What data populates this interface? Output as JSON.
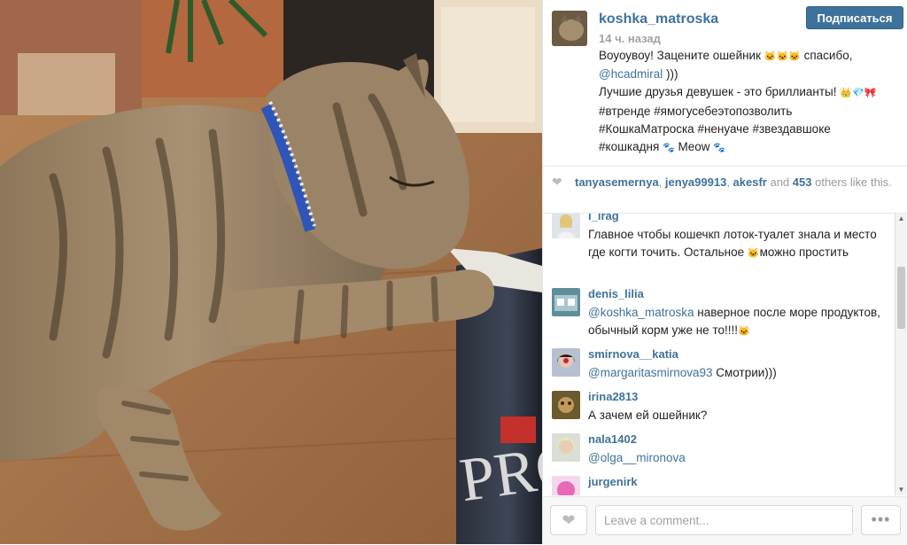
{
  "post": {
    "username": "koshka_matroska",
    "time": "14 ч. назад",
    "follow_label": "Подписаться",
    "caption": {
      "line1_prefix": "Воуоувоу! Зацените ошейник ",
      "line1_emoji": "🐱🐱🐱",
      "line1_suffix": " спасибо,",
      "mention": "@hcadmiral",
      "after_mention": " )))",
      "line3_text": "Лучшие друзья девушек - это бриллианты! ",
      "line3_emoji": "👑💎🎀",
      "hashtags_1": "#втренде #ямогусебеэтопозволить",
      "hashtags_2": "#КошкаМатроска #ненуаче #звездавшоке",
      "hashtags_3_prefix": "#кошкадня ",
      "paw1": "🐾",
      "meow": " Meow ",
      "paw2": "🐾"
    }
  },
  "likes": {
    "heart_icon": "heart-icon",
    "user1": "tanyasemernya",
    "sep1": ", ",
    "user2": "jenya99913",
    "sep2": ", ",
    "user3": "akesfr",
    "and": " and ",
    "count": "453",
    "tail": " others like this."
  },
  "comments": [
    {
      "user": "i_irag",
      "text": "Главное чтобы кошечкп лоток-туалет знала и место где когти точить. Остальное ",
      "emoji": "🐱",
      "tail": "можно простить"
    },
    {
      "user": "denis_lilia",
      "mention": "@koshka_matroska",
      "text": " наверное после море продуктов, обычный корм уже не то!!!!",
      "emoji": "🐱"
    },
    {
      "user": "smirnova__katia",
      "mention": "@margaritasmirnova93",
      "text": " Смотрии)))"
    },
    {
      "user": "irina2813",
      "text": "А зачем ей ошейник?"
    },
    {
      "user": "nala1402",
      "mention": "@olga__mironova",
      "text": ""
    },
    {
      "user": "jurgenirk",
      "text": ""
    }
  ],
  "footer": {
    "like_icon": "heart-icon",
    "comment_placeholder": "Leave a comment...",
    "more_label": "•••"
  },
  "scrollbar": {
    "up": "▲",
    "down": "▼"
  },
  "colors": {
    "link": "#3f729b",
    "follow_bg": "#3f729b"
  }
}
